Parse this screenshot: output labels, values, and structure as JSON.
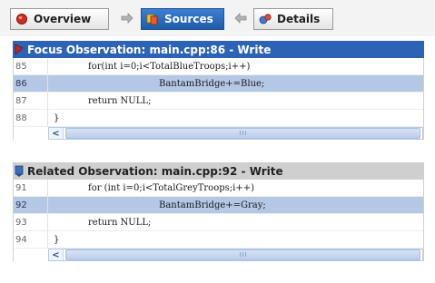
{
  "nav": {
    "overview_label": "Overview",
    "sources_label": "Sources",
    "details_label": "Details",
    "active_tab": "Sources"
  },
  "colors": {
    "focus_header_bg": "#2d63b5",
    "related_header_bg": "#cfcfcf",
    "highlight_row_bg": "#b4c8e6",
    "active_tab_bg": "#2a6cc0",
    "flag_red": "#c62323"
  },
  "focus_panel": {
    "title": "Focus Observation: main.cpp:86 - Write",
    "icon": "red-flag-icon",
    "lines": [
      {
        "number": "85",
        "code": "for(int i=0;i<TotalBlueTroops;i++)",
        "highlighted": false
      },
      {
        "number": "86",
        "code": "BantamBridge+=Blue;",
        "highlighted": true
      },
      {
        "number": "87",
        "code": "return NULL;",
        "highlighted": false
      },
      {
        "number": "88",
        "code": "}",
        "highlighted": false
      }
    ]
  },
  "related_panel": {
    "title": "Related Observation: main.cpp:92 - Write",
    "icon": "blue-flag-icon",
    "lines": [
      {
        "number": "91",
        "code": "for (int i=0;i<TotalGreyTroops;i++)",
        "highlighted": false
      },
      {
        "number": "92",
        "code": "BantamBridge+=Gray;",
        "highlighted": true
      },
      {
        "number": "93",
        "code": "return NULL;",
        "highlighted": false
      },
      {
        "number": "94",
        "code": "}",
        "highlighted": false
      }
    ]
  }
}
